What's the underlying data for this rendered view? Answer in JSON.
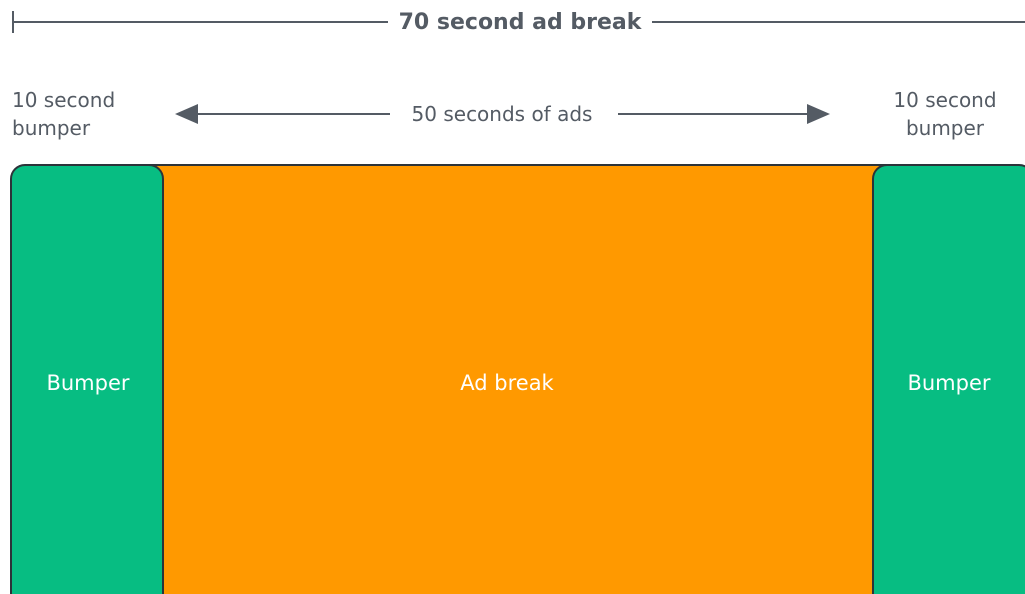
{
  "header": {
    "title": "70 second ad break"
  },
  "annotations": {
    "left_bumper_line1": "10 second",
    "left_bumper_line2": "bumper",
    "ads_duration": "50 seconds of ads",
    "right_bumper_line1": "10 second",
    "right_bumper_line2": "bumper"
  },
  "segments": {
    "left_bumper": "Bumper",
    "ad_break": "Ad break",
    "right_bumper": "Bumper"
  },
  "colors": {
    "text": "#545b64",
    "bumper": "#07bd82",
    "ad_break": "#ff9900",
    "border": "#2c3339",
    "segment_text": "#ffffff"
  }
}
